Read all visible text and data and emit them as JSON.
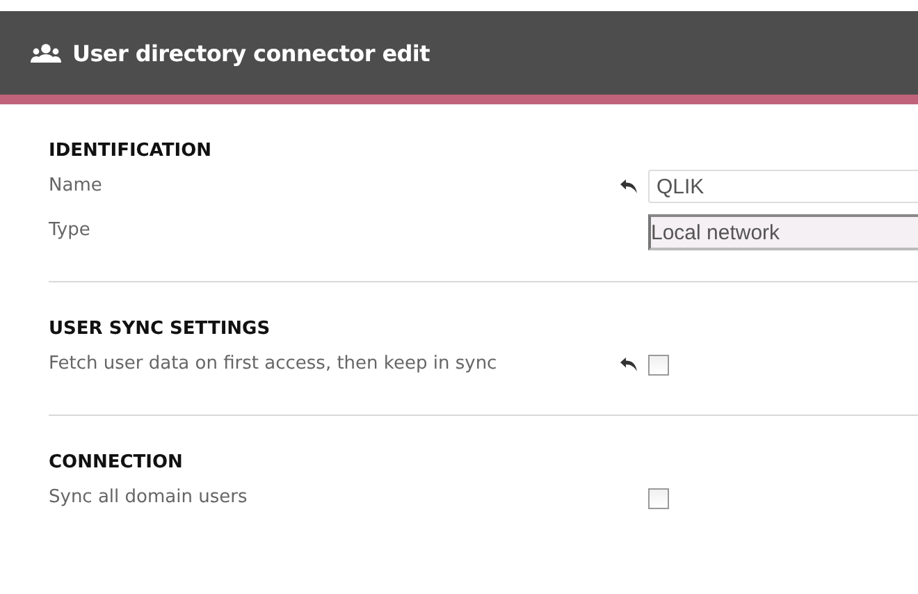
{
  "header": {
    "title": "User directory connector edit"
  },
  "sections": [
    {
      "title": "IDENTIFICATION",
      "rows": [
        {
          "label": "Name",
          "kind": "text",
          "value": "QLIK",
          "revertable": true
        },
        {
          "label": "Type",
          "kind": "select",
          "value": "Local network",
          "revertable": false
        }
      ]
    },
    {
      "title": "USER SYNC SETTINGS",
      "rows": [
        {
          "label": "Fetch user data on first access, then keep in sync",
          "kind": "checkbox",
          "checked": false,
          "revertable": true
        }
      ]
    },
    {
      "title": "CONNECTION",
      "rows": [
        {
          "label": "Sync all domain users",
          "kind": "checkbox",
          "checked": false,
          "revertable": false
        }
      ]
    }
  ]
}
